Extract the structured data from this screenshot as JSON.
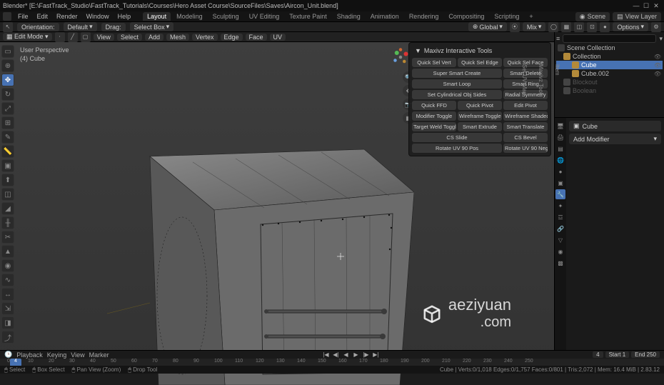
{
  "app": {
    "title": "Blender* [E:\\FastTrack_Studio\\FastTrack_Tutorials\\Courses\\Hero Asset Course\\SourceFiles\\Saves\\Aircon_Unit.blend]"
  },
  "menu": {
    "file": "File",
    "edit": "Edit",
    "render": "Render",
    "window": "Window",
    "help": "Help"
  },
  "workspaces": [
    "Layout",
    "Modeling",
    "Sculpting",
    "UV Editing",
    "Texture Paint",
    "Shading",
    "Animation",
    "Rendering",
    "Compositing",
    "Scripting"
  ],
  "active_workspace": "Layout",
  "scene_selector": "Scene",
  "viewlayer_selector": "View Layer",
  "toolbar2": {
    "orientation": "Orientation:",
    "default": "Default",
    "drag": "Drag:",
    "selectbox": "Select Box",
    "global": "Global",
    "mix": "Mix",
    "options": "Options"
  },
  "editbar": {
    "mode": "Edit Mode",
    "menus": [
      "View",
      "Select",
      "Add",
      "Mesh",
      "Vertex",
      "Edge",
      "Face",
      "UV"
    ]
  },
  "overlay": {
    "line1": "User Perspective",
    "line2": "(4) Cube"
  },
  "maxivz": {
    "title": "Maxivz Interactive Tools",
    "buttons": [
      "Quick Sel Vert",
      "Quick Sel Edge",
      "Quick Sel Face",
      "Super Smart Create",
      "",
      "Smart Delete",
      "Smart Loop",
      "",
      "Smart Ring",
      "Set Cylindrical Obj Sides",
      "",
      "Radial Symmetry",
      "Quick FFD",
      "Quick Pivot",
      "Edit Pivot",
      "Modifier Toggle",
      "Wireframe Toggle",
      "Wireframe Shaded Tog..",
      "Target Weld Toggle",
      "Smart Extrude",
      "Smart Translate",
      "CS Slide",
      "",
      "CS Bevel",
      "Rotate UV 90 Pos",
      "",
      "Rotate UV 90 Neg"
    ],
    "side_tabs": [
      "Item",
      "Maxivz Tools",
      "Set UV Map"
    ]
  },
  "outliner": {
    "scene": "Scene Collection",
    "collection": "Collection",
    "items": [
      {
        "name": "Cube",
        "active": true
      },
      {
        "name": "Cube.002",
        "active": false
      }
    ],
    "disabled": [
      "Blockout",
      "Boolean"
    ]
  },
  "properties": {
    "object_name": "Cube",
    "add_modifier": "Add Modifier"
  },
  "timeline": {
    "menus": [
      "Playback",
      "Keying",
      "View",
      "Marker"
    ],
    "current": "4",
    "start_label": "Start",
    "start": "1",
    "end_label": "End",
    "end": "250",
    "ticks": [
      "0",
      "10",
      "20",
      "30",
      "40",
      "50",
      "60",
      "70",
      "80",
      "90",
      "100",
      "110",
      "120",
      "130",
      "140",
      "150",
      "160",
      "170",
      "180",
      "190",
      "200",
      "210",
      "220",
      "230",
      "240",
      "250"
    ]
  },
  "status": {
    "select": "Select",
    "box_select": "Box Select",
    "pan": "Pan View (Zoom)",
    "drop": "Drop Tool",
    "right": "Cube | Verts:0/1,018  Edges:0/1,757  Faces:0/801 | Tris:2,072 | Mem: 16.4 MiB | 2.83.12"
  },
  "watermark": {
    "text1": "aeziyuan",
    "text2": ".com"
  }
}
